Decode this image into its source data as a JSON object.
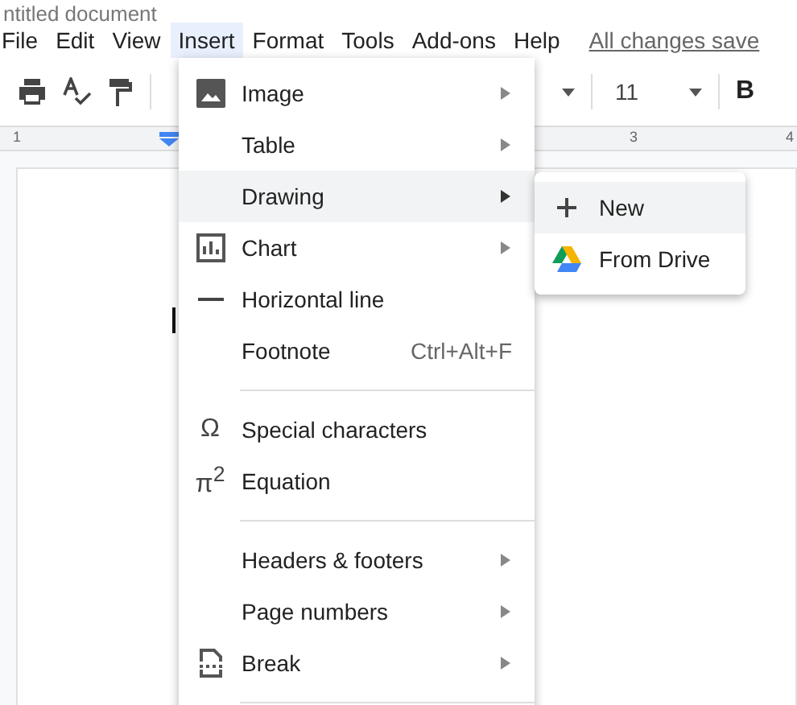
{
  "document_title": "ntitled document",
  "menu_bar": [
    {
      "label": "File",
      "selected": false
    },
    {
      "label": "Edit",
      "selected": false
    },
    {
      "label": "View",
      "selected": false
    },
    {
      "label": "Insert",
      "selected": true
    },
    {
      "label": "Format",
      "selected": false
    },
    {
      "label": "Tools",
      "selected": false
    },
    {
      "label": "Add-ons",
      "selected": false
    },
    {
      "label": "Help",
      "selected": false
    }
  ],
  "save_status": "All changes save",
  "toolbar": {
    "font_size": "11",
    "bold": "B"
  },
  "ruler": [
    "1",
    "3",
    "4"
  ],
  "insert_menu": [
    {
      "kind": "image",
      "label": "Image",
      "submenu": true,
      "selected": false
    },
    {
      "kind": "plain",
      "label": "Table",
      "submenu": true,
      "selected": false
    },
    {
      "kind": "plain",
      "label": "Drawing",
      "submenu": true,
      "selected": true
    },
    {
      "kind": "chart",
      "label": "Chart",
      "submenu": true,
      "selected": false
    },
    {
      "kind": "line",
      "label": "Horizontal line",
      "submenu": false,
      "selected": false
    },
    {
      "kind": "plain",
      "label": "Footnote",
      "shortcut": "Ctrl+Alt+F",
      "submenu": false,
      "selected": false
    },
    {
      "kind": "divider"
    },
    {
      "kind": "symbol",
      "icon_text": "Ω",
      "label": "Special characters",
      "submenu": false,
      "selected": false
    },
    {
      "kind": "symbol",
      "icon_text": "π$^{2}$",
      "label": "Equation",
      "submenu": false,
      "selected": false
    },
    {
      "kind": "divider"
    },
    {
      "kind": "plain",
      "label": "Headers & footers",
      "submenu": true,
      "selected": false
    },
    {
      "kind": "plain",
      "label": "Page numbers",
      "submenu": true,
      "selected": false
    },
    {
      "kind": "break",
      "label": "Break",
      "submenu": true,
      "selected": false
    },
    {
      "kind": "divider"
    }
  ],
  "drawing_submenu": [
    {
      "kind": "new",
      "label": "New",
      "selected": true
    },
    {
      "kind": "drive",
      "label": "From Drive",
      "selected": false
    }
  ]
}
